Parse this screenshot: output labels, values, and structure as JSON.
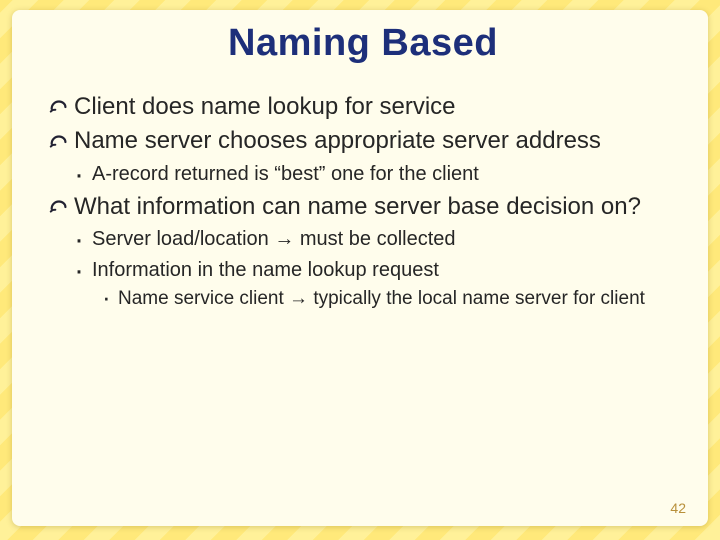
{
  "slide": {
    "title": "Naming Based",
    "bullets": [
      {
        "text": "Client does name lookup for service"
      },
      {
        "text": "Name server chooses appropriate server address",
        "sub": [
          {
            "text": "A-record returned is “best” one for the client"
          }
        ]
      },
      {
        "text": "What information can name server base decision on?",
        "sub": [
          {
            "text": "Server load/location → must be collected"
          },
          {
            "text": "Information in the name lookup request",
            "subsub": [
              {
                "text": "Name service client → typically the local name server for client"
              }
            ]
          }
        ]
      }
    ],
    "page_number": "42"
  }
}
